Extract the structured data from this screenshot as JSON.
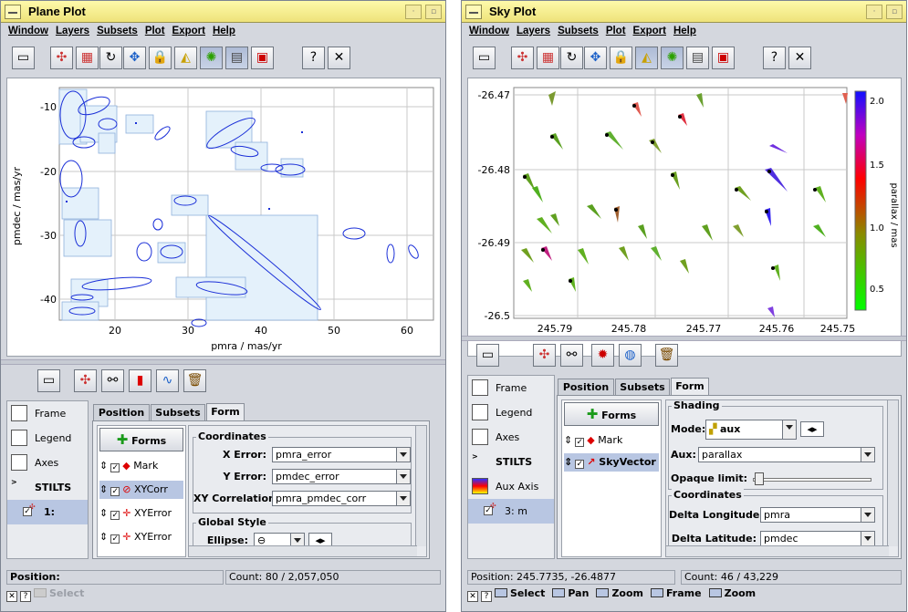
{
  "windows": [
    {
      "title": "Plane Plot",
      "menu": [
        "Window",
        "Layers",
        "Subsets",
        "Plot",
        "Export",
        "Help"
      ],
      "plot": {
        "xlabel": "pmra / mas/yr",
        "ylabel": "pmdec / mas/yr",
        "xticks": [
          "20",
          "30",
          "40",
          "50",
          "60"
        ],
        "yticks": [
          "-10",
          "-20",
          "-30",
          "-40"
        ]
      },
      "controls": [
        {
          "label": "Frame",
          "icon": "frame-icon"
        },
        {
          "label": "Legend",
          "icon": "legend-icon"
        },
        {
          "label": "Axes",
          "icon": "axes-icon"
        },
        {
          "label": "STILTS",
          "icon": "stilts-icon"
        },
        {
          "label": "1:",
          "icon": "layer-icon"
        }
      ],
      "tabs": [
        "Position",
        "Subsets",
        "Form"
      ],
      "active_tab": "Form",
      "forms_button": "Forms",
      "layers": [
        {
          "label": "Mark",
          "icon": "mark-icon"
        },
        {
          "label": "XYCorr",
          "icon": "xycorr-icon"
        },
        {
          "label": "XYError",
          "icon": "xyerror-icon"
        },
        {
          "label": "XYError",
          "icon": "xyerror-icon"
        }
      ],
      "groups": {
        "coordinates": "Coordinates",
        "global_style": "Global Style"
      },
      "fields": [
        {
          "label": "X Error:",
          "value": "pmra_error"
        },
        {
          "label": "Y Error:",
          "value": "pmdec_error"
        },
        {
          "label": "XY Correlation:",
          "value": "pmra_pmdec_corr"
        }
      ],
      "ellipse_label": "Ellipse:",
      "status": {
        "position": "Position:",
        "count": "Count: 80 / 2,057,050"
      },
      "bottom": {
        "help": "?",
        "select": "Select"
      }
    },
    {
      "title": "Sky Plot",
      "menu": [
        "Window",
        "Layers",
        "Subsets",
        "Plot",
        "Export",
        "Help"
      ],
      "plot": {
        "xticks": [
          "245.79",
          "245.78",
          "245.77",
          "245.76",
          "245.75"
        ],
        "yticks": [
          "-26.47",
          "-26.48",
          "-26.49",
          "-26.5"
        ],
        "colorbar_label": "parallax / mas",
        "colorbar_ticks": [
          "2.0",
          "1.5",
          "1.0",
          "0.5"
        ]
      },
      "controls": [
        {
          "label": "Frame",
          "icon": "frame-icon"
        },
        {
          "label": "Legend",
          "icon": "legend-icon"
        },
        {
          "label": "Axes",
          "icon": "axes-icon"
        },
        {
          "label": "STILTS",
          "icon": "stilts-icon"
        },
        {
          "label": "Aux Axis",
          "icon": "aux-axis-icon"
        },
        {
          "label": "3: m",
          "icon": "layer-icon"
        }
      ],
      "tabs": [
        "Position",
        "Subsets",
        "Form"
      ],
      "active_tab": "Form",
      "forms_button": "Forms",
      "layers": [
        {
          "label": "Mark",
          "icon": "mark-icon"
        },
        {
          "label": "SkyVector",
          "icon": "skyvector-icon"
        }
      ],
      "groups": {
        "shading": "Shading",
        "coordinates": "Coordinates"
      },
      "mode": {
        "label": "Mode:",
        "value": "aux"
      },
      "aux": {
        "label": "Aux:",
        "value": "parallax"
      },
      "opaque_label": "Opaque limit:",
      "fields": [
        {
          "label": "Delta Longitude:",
          "value": "pmra"
        },
        {
          "label": "Delta Latitude:",
          "value": "pmdec"
        }
      ],
      "status": {
        "position": "Position: 245.7735, -26.4877",
        "count": "Count: 46 / 43,229"
      },
      "bottom": {
        "help": "?",
        "select": "Select",
        "pan": "Pan",
        "zoom": "Zoom",
        "frame": "Frame",
        "zoom2": "Zoom"
      }
    }
  ]
}
